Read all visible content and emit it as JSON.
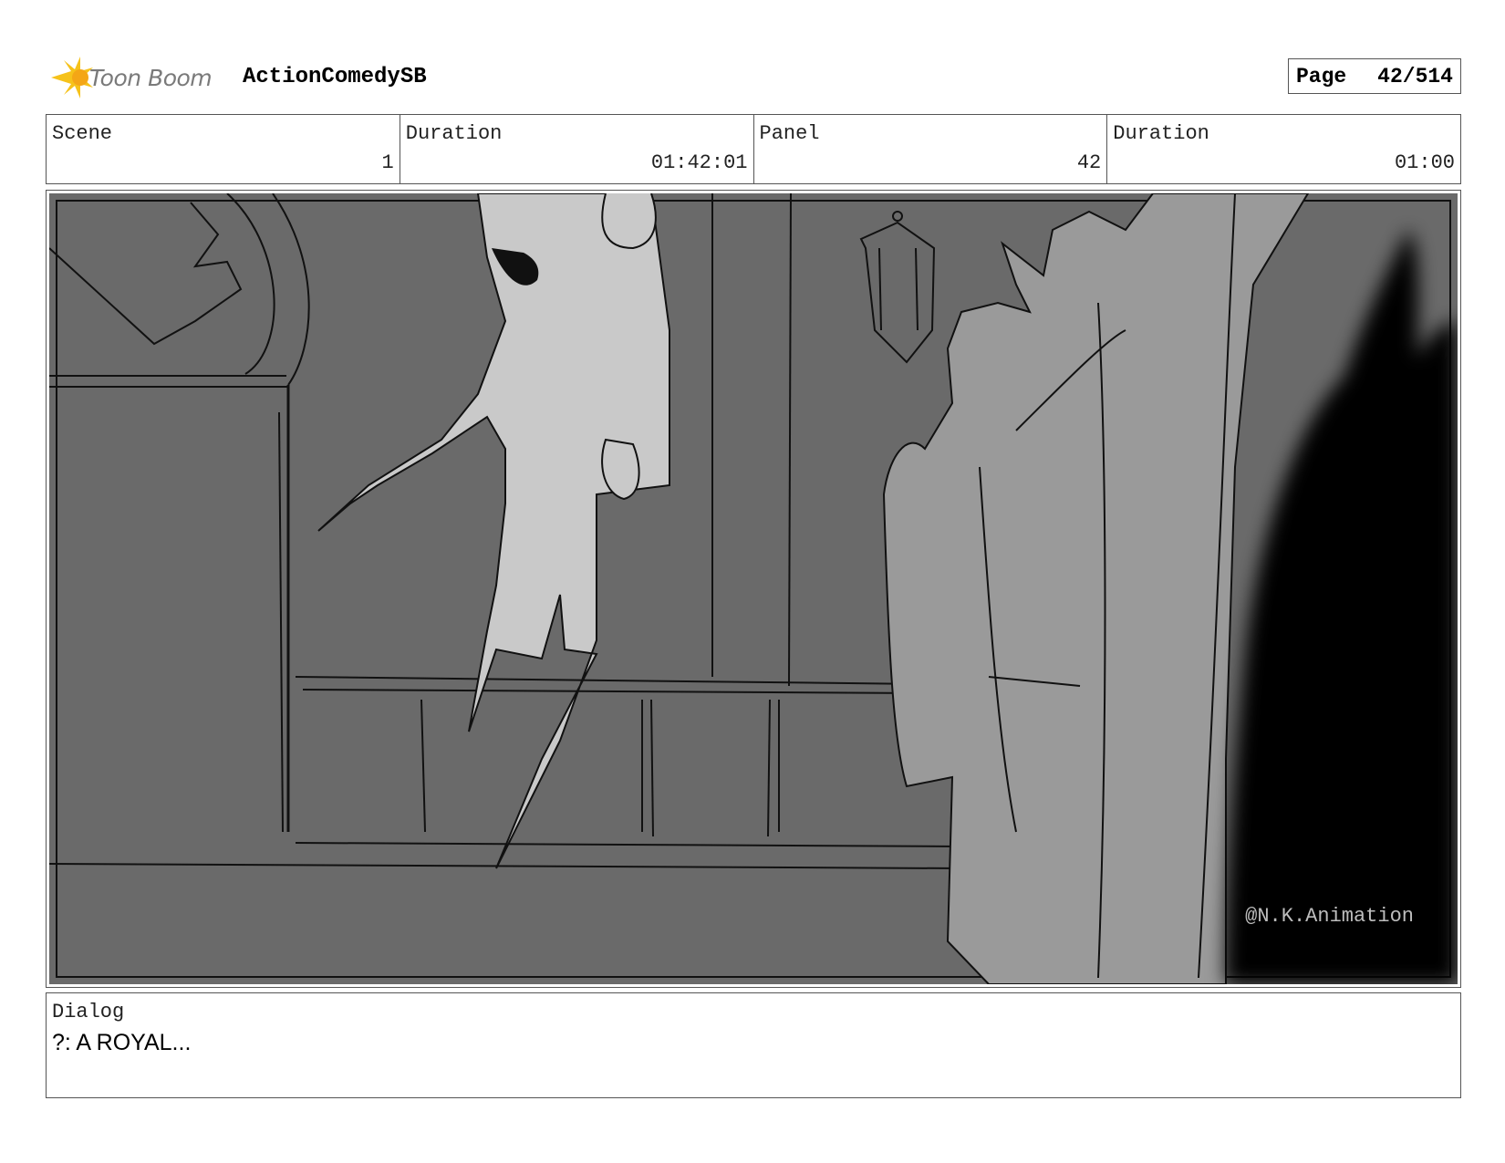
{
  "header": {
    "logo_text": "Toon Boom",
    "project_title": "ActionComedySB",
    "page_label": "Page",
    "page_value": "42/514"
  },
  "info": {
    "scene_label": "Scene",
    "scene_value": "1",
    "scene_duration_label": "Duration",
    "scene_duration_value": "01:42:01",
    "panel_label": "Panel",
    "panel_value": "42",
    "panel_duration_label": "Duration",
    "panel_duration_value": "01:00"
  },
  "panel": {
    "watermark": "@N.K.Animation"
  },
  "dialog": {
    "label": "Dialog",
    "text": "?: A ROYAL..."
  },
  "colors": {
    "wall": "#6a6a6a",
    "ghost": "#c9c9c9",
    "figures": "#9a9a9a",
    "silhouette": "#000000"
  }
}
